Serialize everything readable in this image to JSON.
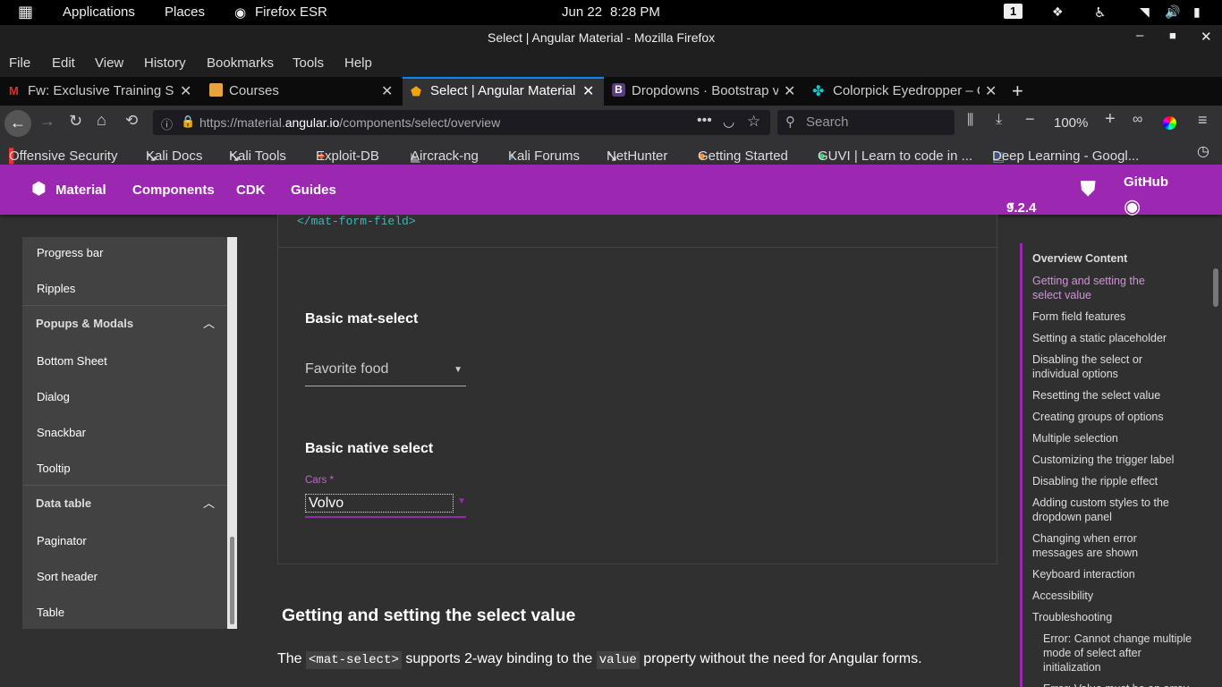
{
  "gnome": {
    "applications": "Applications",
    "places": "Places",
    "browser": "Firefox ESR",
    "date": "Jun 22",
    "time": "8:28 PM",
    "workspace": "1"
  },
  "window": {
    "title": "Select | Angular Material - Mozilla Firefox"
  },
  "menu": [
    "File",
    "Edit",
    "View",
    "History",
    "Bookmarks",
    "Tools",
    "Help"
  ],
  "tabs": [
    {
      "label": "Fw: Exclusive Training Se"
    },
    {
      "label": "Courses"
    },
    {
      "label": "Select | Angular Material"
    },
    {
      "label": "Dropdowns · Bootstrap v"
    },
    {
      "label": "Colorpick Eyedropper – C"
    }
  ],
  "nav": {
    "url_prefix": "https://material.",
    "url_domain": "angular.io",
    "url_path": "/components/select/overview",
    "search_placeholder": "Search",
    "zoom": "100%"
  },
  "bookmarks": [
    "Offensive Security",
    "Kali Docs",
    "Kali Tools",
    "Exploit-DB",
    "Aircrack-ng",
    "Kali Forums",
    "NetHunter",
    "Getting Started",
    "GUVI | Learn to code in ...",
    "Deep Learning - Googl..."
  ],
  "toolbar": {
    "brand": "Material",
    "components": "Components",
    "cdk": "CDK",
    "guides": "Guides",
    "version": "9.2.4",
    "github": "GitHub"
  },
  "sidenav": {
    "items_top": [
      "Progress bar",
      "Ripples"
    ],
    "group1": "Popups & Modals",
    "group1_items": [
      "Bottom Sheet",
      "Dialog",
      "Snackbar",
      "Tooltip"
    ],
    "group2": "Data table",
    "group2_items": [
      "Paginator",
      "Sort header",
      "Table"
    ]
  },
  "example": {
    "code_close": "</mat-form-field>",
    "basic_title": "Basic mat-select",
    "basic_placeholder": "Favorite food",
    "native_title": "Basic native select",
    "native_label": "Cars",
    "native_required": "*",
    "native_value": "Volvo"
  },
  "content": {
    "heading": "Getting and setting the select value",
    "p_the": "The",
    "p_code1": "<mat-select>",
    "p_mid": "supports 2-way binding to the",
    "p_code2": "value",
    "p_end": "property without the need for Angular forms."
  },
  "toc": {
    "title": "Overview Content",
    "items": [
      "Getting and setting the select value",
      "Form field features",
      "Setting a static placeholder",
      "Disabling the select or individual options",
      "Resetting the select value",
      "Creating groups of options",
      "Multiple selection",
      "Customizing the trigger label",
      "Disabling the ripple effect",
      "Adding custom styles to the dropdown panel",
      "Changing when error messages are shown",
      "Keyboard interaction",
      "Accessibility",
      "Troubleshooting"
    ],
    "sub1": "Error: Cannot change multiple mode of select after initialization",
    "sub2": "Error: Value must be an array"
  },
  "colors": {
    "accent": "#9c27b0",
    "active_toc": "#ce93d8"
  }
}
